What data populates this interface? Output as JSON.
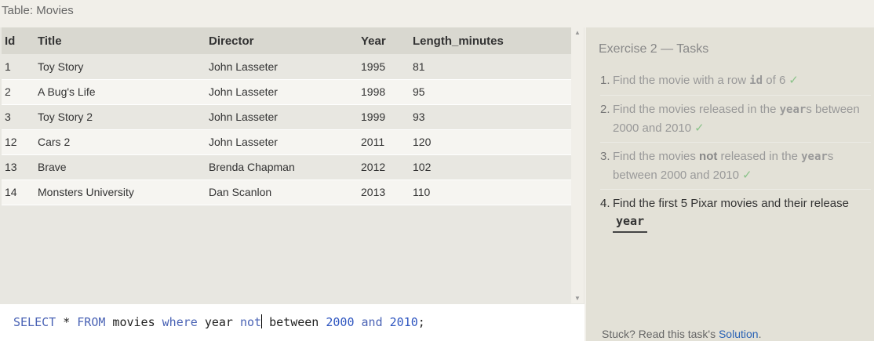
{
  "table_caption": "Table: Movies",
  "columns": [
    "Id",
    "Title",
    "Director",
    "Year",
    "Length_minutes"
  ],
  "rows": [
    [
      "1",
      "Toy Story",
      "John Lasseter",
      "1995",
      "81"
    ],
    [
      "2",
      "A Bug's Life",
      "John Lasseter",
      "1998",
      "95"
    ],
    [
      "3",
      "Toy Story 2",
      "John Lasseter",
      "1999",
      "93"
    ],
    [
      "12",
      "Cars 2",
      "John Lasseter",
      "2011",
      "120"
    ],
    [
      "13",
      "Brave",
      "Brenda Chapman",
      "2012",
      "102"
    ],
    [
      "14",
      "Monsters University",
      "Dan Scanlon",
      "2013",
      "110"
    ]
  ],
  "editor": {
    "t1": "SELECT",
    "t2": " * ",
    "t3": "FROM",
    "t4": " movies ",
    "t5": "where",
    "t6": " year ",
    "t7": "not",
    "t8": " between ",
    "t9": "2000",
    "t10": " ",
    "t11": "and",
    "t12": " ",
    "t13": "2010",
    "t14": ";"
  },
  "exercise_title": "Exercise 2 — Tasks",
  "tasks": {
    "t1": {
      "num": "1.",
      "pre": "Find the movie with a row ",
      "code": "id",
      "post": " of 6",
      "check": "✓"
    },
    "t2": {
      "num": "2.",
      "pre": "Find the movies released in the ",
      "code": "year",
      "post": "s between 2000 and 2010",
      "check": "✓"
    },
    "t3": {
      "num": "3.",
      "pre": "Find the movies ",
      "strong": "not",
      "mid": " released in the ",
      "code": "year",
      "post": "s between 2000 and 2010",
      "check": "✓"
    },
    "t4": {
      "num": "4.",
      "pre": "Find the first 5 Pixar movies and their release",
      "code": "year"
    }
  },
  "stuck": {
    "text": "Stuck? Read this task's ",
    "link": "Solution",
    "end": "."
  }
}
